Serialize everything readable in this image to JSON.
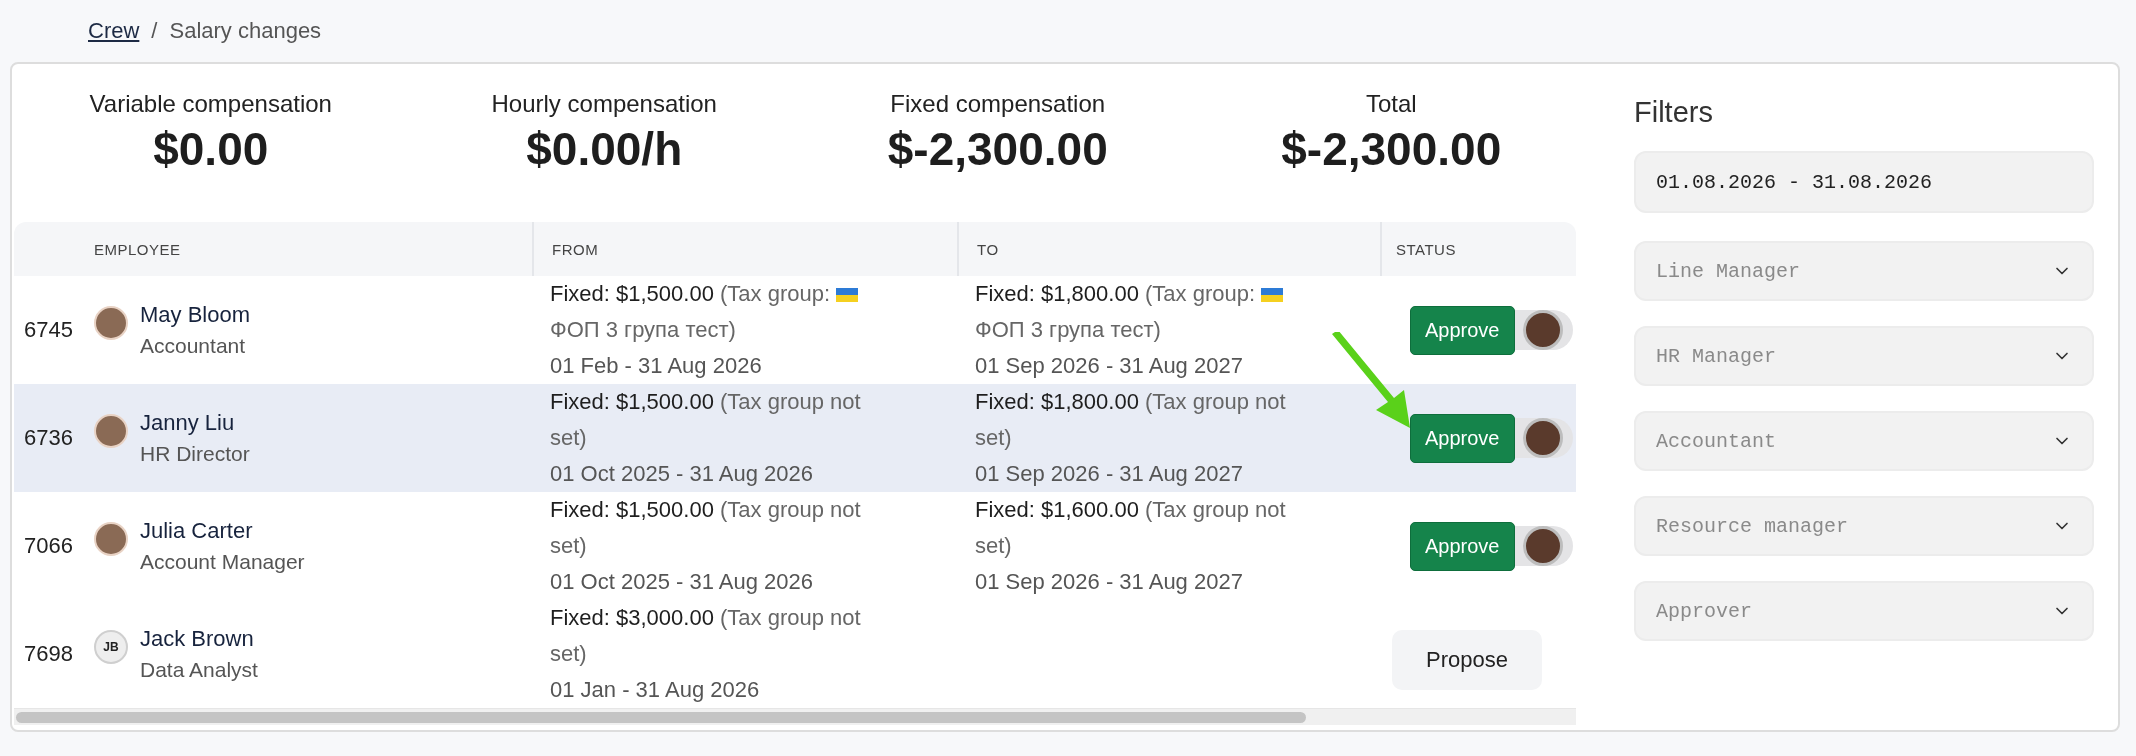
{
  "breadcrumb": {
    "link": "Crew",
    "separator": "/",
    "current": "Salary changes"
  },
  "stats": [
    {
      "label": "Variable compensation",
      "value": "$0.00"
    },
    {
      "label": "Hourly compensation",
      "value": "$0.00/h"
    },
    {
      "label": "Fixed compensation",
      "value": "$-2,300.00"
    },
    {
      "label": "Total",
      "value": "$-2,300.00"
    }
  ],
  "table": {
    "columns": [
      "EMPLOYEE",
      "FROM",
      "TO",
      "STATUS"
    ],
    "rows": [
      {
        "id": "6745",
        "name": "May Bloom",
        "role": "Accountant",
        "selected": false,
        "from": {
          "text": "**Fixed: $1,500.00** (Tax group:",
          "flag": true,
          "after": "ФОП 3 група тест)",
          "period": "01 Feb - 31 Aug 2026"
        },
        "to": {
          "text": "**Fixed: $1,800.00** (Tax group:",
          "flag": true,
          "after": "ФОП 3 група тест)",
          "period": "01 Sep 2026 - 31 Aug 2027"
        },
        "status": {
          "kind": "approve",
          "label": "Approve"
        }
      },
      {
        "id": "6736",
        "name": "Janny Liu",
        "role": "HR Director",
        "selected": true,
        "from": {
          "text": "**Fixed: $1,500.00** (Tax group not set)",
          "period": "01 Oct 2025 - 31 Aug 2026"
        },
        "to": {
          "text": "**Fixed: $1,800.00** (Tax group not set)",
          "period": "01 Sep 2026 - 31 Aug 2027"
        },
        "status": {
          "kind": "approve",
          "label": "Approve"
        }
      },
      {
        "id": "7066",
        "name": "Julia Carter",
        "role": "Account Manager",
        "selected": false,
        "from": {
          "text": "**Fixed: $1,500.00** (Tax group not set)",
          "period": "01 Oct 2025 - 31 Aug 2026"
        },
        "to": {
          "text": "**Fixed: $1,600.00** (Tax group not set)",
          "period": "01 Sep 2026 - 31 Aug 2027"
        },
        "status": {
          "kind": "approve",
          "label": "Approve"
        }
      },
      {
        "id": "7698",
        "name": "Jack Brown",
        "role": "Data Analyst",
        "initials": "JB",
        "selected": false,
        "from": {
          "text": "**Fixed: $3,000.00** (Tax group not set)",
          "period": "01 Jan - 31 Aug 2026"
        },
        "status": {
          "kind": "propose",
          "label": "Propose"
        }
      }
    ]
  },
  "filters": {
    "title": "Filters",
    "date_range": "01.08.2026 - 31.08.2026",
    "selects": [
      {
        "placeholder": "Line Manager"
      },
      {
        "placeholder": "HR Manager"
      },
      {
        "placeholder": "Accountant"
      },
      {
        "placeholder": "Resource manager"
      },
      {
        "placeholder": "Approver"
      }
    ]
  }
}
